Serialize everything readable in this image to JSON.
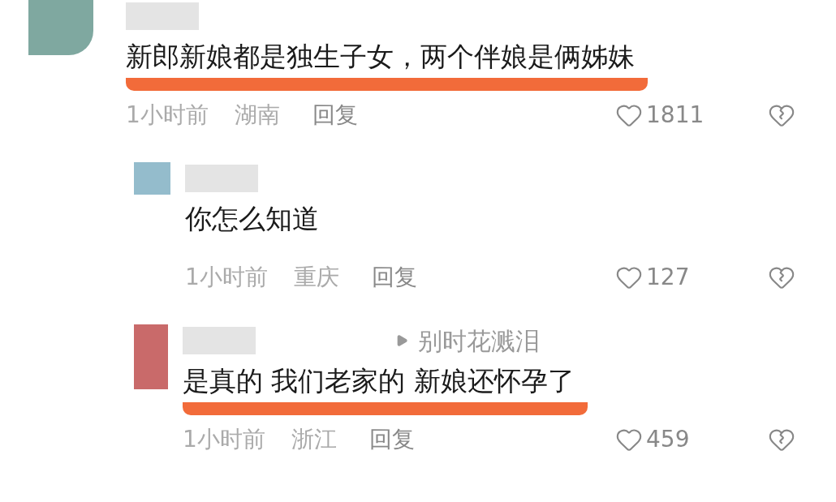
{
  "comments": [
    {
      "kind": "comment",
      "text": "新郎新娘都是独生子女，两个伴娘是俩姊妹",
      "time": "1小时前",
      "location": "湖南",
      "reply": "回复",
      "likes": "1811",
      "highlighted": true
    },
    {
      "kind": "reply",
      "text": "你怎么知道",
      "time": "1小时前",
      "location": "重庆",
      "reply": "回复",
      "likes": "127",
      "highlighted": false
    },
    {
      "kind": "reply",
      "reply_to": "别时花溅泪",
      "text": "是真的 我们老家的 新娘还怀孕了",
      "time": "1小时前",
      "location": "浙江",
      "reply": "回复",
      "likes": "459",
      "highlighted": true
    }
  ]
}
